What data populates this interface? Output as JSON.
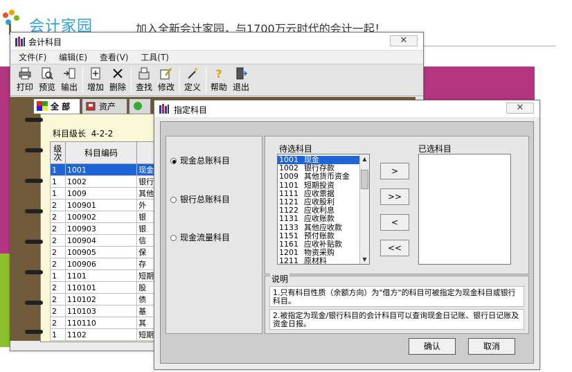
{
  "site": {
    "logo_text": "会计家园",
    "slogan": "加入全新会计家园，与1700万云时代的会计一起！"
  },
  "main_window": {
    "title": "会计科目",
    "menu": [
      "文件(F)",
      "编辑(E)",
      "查看(V)",
      "工具(T)"
    ],
    "toolbar": [
      {
        "label": "打印",
        "icon": "printer-icon"
      },
      {
        "label": "预览",
        "icon": "preview-icon"
      },
      {
        "label": "输出",
        "icon": "export-icon"
      },
      {
        "label": "增加",
        "icon": "add-icon"
      },
      {
        "label": "删除",
        "icon": "delete-icon"
      },
      {
        "label": "查找",
        "icon": "find-icon"
      },
      {
        "label": "修改",
        "icon": "edit-icon"
      },
      {
        "label": "定义",
        "icon": "wand-icon"
      },
      {
        "label": "帮助",
        "icon": "help-icon"
      },
      {
        "label": "退出",
        "icon": "exit-icon"
      }
    ],
    "tabs": [
      {
        "label": "全 部",
        "active": true
      },
      {
        "label": "资产",
        "active": false
      }
    ],
    "level_label": "科目级长",
    "level_value": "4-2-2",
    "table": {
      "headers": [
        "级次",
        "科目编码"
      ],
      "rows": [
        {
          "level": "1",
          "code": "1001",
          "name": "现金",
          "selected": true
        },
        {
          "level": "1",
          "code": "1002",
          "name": "银行"
        },
        {
          "level": "1",
          "code": "1009",
          "name": "其他"
        },
        {
          "level": "2",
          "code": "100901",
          "name": "外"
        },
        {
          "level": "2",
          "code": "100902",
          "name": "银"
        },
        {
          "level": "2",
          "code": "100903",
          "name": "银"
        },
        {
          "level": "2",
          "code": "100904",
          "name": "信"
        },
        {
          "level": "2",
          "code": "100905",
          "name": "保"
        },
        {
          "level": "2",
          "code": "100906",
          "name": "存"
        },
        {
          "level": "1",
          "code": "1101",
          "name": "短期"
        },
        {
          "level": "2",
          "code": "110101",
          "name": "股"
        },
        {
          "level": "2",
          "code": "110102",
          "name": "债"
        },
        {
          "level": "2",
          "code": "110103",
          "name": "基"
        },
        {
          "level": "2",
          "code": "110110",
          "name": "其"
        },
        {
          "level": "1",
          "code": "1102",
          "name": "短期"
        }
      ]
    }
  },
  "dialog": {
    "title": "指定科目",
    "radios": [
      {
        "label": "现金总账科目",
        "checked": true
      },
      {
        "label": "银行总账科目",
        "checked": false
      },
      {
        "label": "现金流量科目",
        "checked": false
      }
    ],
    "candidates_label": "待选科目",
    "chosen_label": "已选科目",
    "candidates": [
      {
        "code": "1001",
        "name": "现金",
        "selected": true
      },
      {
        "code": "1002",
        "name": "银行存款"
      },
      {
        "code": "1009",
        "name": "其他货币资金"
      },
      {
        "code": "1101",
        "name": "短期投资"
      },
      {
        "code": "1111",
        "name": "应收票据"
      },
      {
        "code": "1121",
        "name": "应收股利"
      },
      {
        "code": "1122",
        "name": "应收利息"
      },
      {
        "code": "1131",
        "name": "应收账款"
      },
      {
        "code": "1133",
        "name": "其他应收款"
      },
      {
        "code": "1151",
        "name": "预付账款"
      },
      {
        "code": "1161",
        "name": "应收补贴款"
      },
      {
        "code": "1201",
        "name": "物资采购"
      },
      {
        "code": "1211",
        "name": "原材料"
      }
    ],
    "move_buttons": [
      ">",
      ">>",
      "<",
      "<<"
    ],
    "notes_title": "说明",
    "notes": [
      "1.只有科目性质（余额方向）为\"借方\"的科目可被指定为现金科目或银行科目。",
      "2.被指定为现金/银行科目的会计科目可以查询现金日记账、银行日记账及资金日报。"
    ],
    "ok_label": "确认",
    "cancel_label": "取消"
  }
}
